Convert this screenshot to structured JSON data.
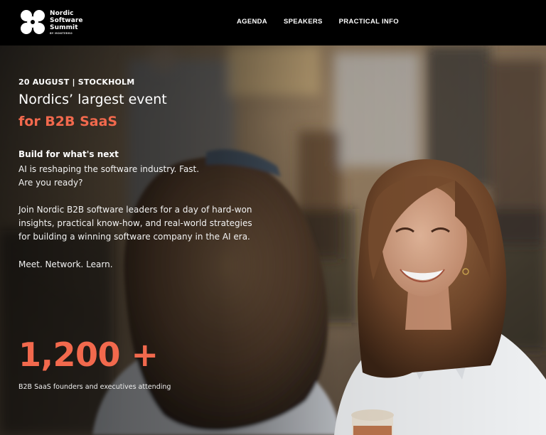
{
  "header": {
    "logo": {
      "line1": "Nordic",
      "line2": "Software",
      "line3": "Summit",
      "sub": "BY MONTERRO"
    },
    "nav": [
      {
        "label": "AGENDA"
      },
      {
        "label": "SPEAKERS"
      },
      {
        "label": "PRACTICAL INFO"
      }
    ]
  },
  "hero": {
    "eyebrow": "20 AUGUST | STOCKHOLM",
    "title_line1": "Nordics’ largest event",
    "title_line2": "for B2B SaaS",
    "lead": "Build for what's next",
    "para1": [
      "AI is reshaping the software industry. Fast.",
      "Are you ready?"
    ],
    "para2": [
      "Join Nordic B2B software leaders for a day of hard-won",
      "insights, practical know-how, and real-world strategies",
      "for building a winning software company in the AI era."
    ],
    "para3": "Meet. Network. Learn.",
    "stat_number": "1,200 +",
    "stat_label": "B2B SaaS founders and executives attending"
  },
  "colors": {
    "accent": "#f2694d",
    "header_bg": "#000000",
    "text": "#ffffff"
  }
}
